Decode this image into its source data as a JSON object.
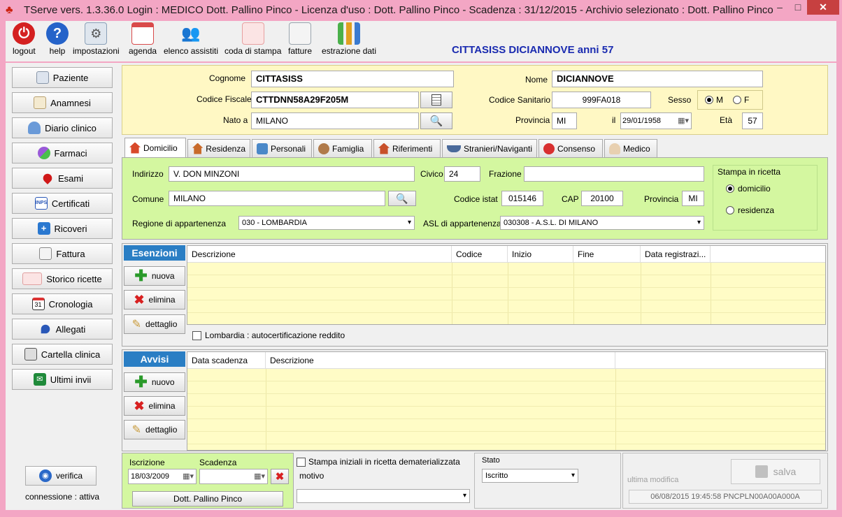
{
  "window": {
    "title": "TServe vers. 1.3.36.0  Login : MEDICO Dott. Pallino Pinco - Licenza d'uso : Dott. Pallino Pinco - Scadenza : 31/12/2015 - Archivio selezionato : Dott. Pallino Pinco",
    "minimize": "–",
    "maximize": "□",
    "close": "✕"
  },
  "toolbar": {
    "items": [
      {
        "label": "logout",
        "icon": "power-icon",
        "color": "#d42020"
      },
      {
        "label": "help",
        "icon": "help-icon",
        "color": "#2563c9"
      },
      {
        "label": "impostazioni",
        "icon": "settings-icon",
        "color": "#8aa0b8"
      },
      {
        "label": "agenda",
        "icon": "calendar-icon",
        "color": "#d94a4a"
      },
      {
        "label": "elenco assistiti",
        "icon": "users-icon",
        "color": "#c98a4a"
      },
      {
        "label": "coda di stampa",
        "icon": "print-queue-icon",
        "color": "#e8a0a0"
      },
      {
        "label": "fatture",
        "icon": "invoice-icon",
        "color": "#9aa4ad"
      },
      {
        "label": "estrazione dati",
        "icon": "chart-icon",
        "color": "#4ab04a"
      }
    ],
    "patient_header": "CITTASISS DICIANNOVE anni 57"
  },
  "sidebar": {
    "items": [
      {
        "label": "Paziente",
        "icon": "patient-card-icon"
      },
      {
        "label": "Anamnesi",
        "icon": "anamnesis-icon"
      },
      {
        "label": "Diario clinico",
        "icon": "doctor-icon"
      },
      {
        "label": "Farmaci",
        "icon": "pills-icon"
      },
      {
        "label": "Esami",
        "icon": "blood-drop-icon"
      },
      {
        "label": "Certificati",
        "icon": "inps-icon"
      },
      {
        "label": "Ricoveri",
        "icon": "hospital-icon"
      },
      {
        "label": "Fattura",
        "icon": "invoice-icon"
      },
      {
        "label": "Storico ricette",
        "icon": "prescription-icon"
      },
      {
        "label": "Cronologia",
        "icon": "calendar-31-icon"
      },
      {
        "label": "Allegati",
        "icon": "pin-icon"
      },
      {
        "label": "Cartella clinica",
        "icon": "printer-icon"
      },
      {
        "label": "Ultimi invii",
        "icon": "send-icon"
      }
    ],
    "verify_label": "verifica",
    "connection_label": "connessione : attiva"
  },
  "patient": {
    "cognome_label": "Cognome",
    "cognome": "CITTASISS",
    "nome_label": "Nome",
    "nome": "DICIANNOVE",
    "cf_label": "Codice Fiscale",
    "cf": "CTTDNN58A29F205M",
    "cod_san_label": "Codice Sanitario",
    "cod_san": "999FA018",
    "sesso_label": "Sesso",
    "sesso_m": "M",
    "sesso_f": "F",
    "nato_label": "Nato a",
    "nato": "MILANO",
    "provincia_label": "Provincia",
    "provincia": "MI",
    "il_label": "il",
    "data_nascita": "29/01/1958",
    "eta_label": "Età",
    "eta": "57"
  },
  "tabs": [
    {
      "label": "Domicilio",
      "icon": "home-icon",
      "active": true
    },
    {
      "label": "Residenza",
      "icon": "house-icon"
    },
    {
      "label": "Personali",
      "icon": "phone-icon"
    },
    {
      "label": "Famiglia",
      "icon": "family-icon"
    },
    {
      "label": "Riferimenti",
      "icon": "houses-icon"
    },
    {
      "label": "Stranieri/Naviganti",
      "icon": "ship-icon"
    },
    {
      "label": "Consenso",
      "icon": "no-entry-icon"
    },
    {
      "label": "Medico",
      "icon": "doctor-icon"
    }
  ],
  "domicilio": {
    "indirizzo_label": "Indirizzo",
    "indirizzo": "V. DON MINZONI",
    "civico_label": "Civico",
    "civico": "24",
    "frazione_label": "Frazione",
    "frazione": "",
    "comune_label": "Comune",
    "comune": "MILANO",
    "codice_istat_label": "Codice istat",
    "codice_istat": "015146",
    "cap_label": "CAP",
    "cap": "20100",
    "provincia_label": "Provincia",
    "provincia": "MI",
    "regione_label": "Regione di appartenenza",
    "regione": "030 - LOMBARDIA",
    "asl_label": "ASL di appartenenza",
    "asl": "030308 - A.S.L. DI MILANO",
    "stampa_title": "Stampa in ricetta",
    "stampa_domicilio": "domicilio",
    "stampa_residenza": "residenza"
  },
  "esenzioni": {
    "title": "Esenzioni",
    "new_label": "nuova",
    "delete_label": "elimina",
    "detail_label": "dettaglio",
    "columns": [
      "Descrizione",
      "Codice",
      "Inizio",
      "Fine",
      "Data registrazi..."
    ],
    "rows": [],
    "autocert_label": "Lombardia : autocertificazione reddito"
  },
  "avvisi": {
    "title": "Avvisi",
    "new_label": "nuovo",
    "delete_label": "elimina",
    "detail_label": "dettaglio",
    "columns": [
      "Data scadenza",
      "Descrizione"
    ],
    "rows": []
  },
  "bottom": {
    "iscrizione_label": "Iscrizione",
    "iscrizione": "18/03/2009",
    "scadenza_label": "Scadenza",
    "scadenza": "",
    "doctor_button": "Dott. Pallino Pinco",
    "stampa_iniziali_label": "Stampa iniziali in ricetta dematerializzata",
    "motivo_label": "motivo",
    "motivo": "",
    "stato_label": "Stato",
    "stato": "Iscritto",
    "salva_label": "salva",
    "ultima_modifica_label": "ultima modifica",
    "ultima_modifica": "06/08/2015 19:45:58 PNCPLN00A00A000A"
  }
}
